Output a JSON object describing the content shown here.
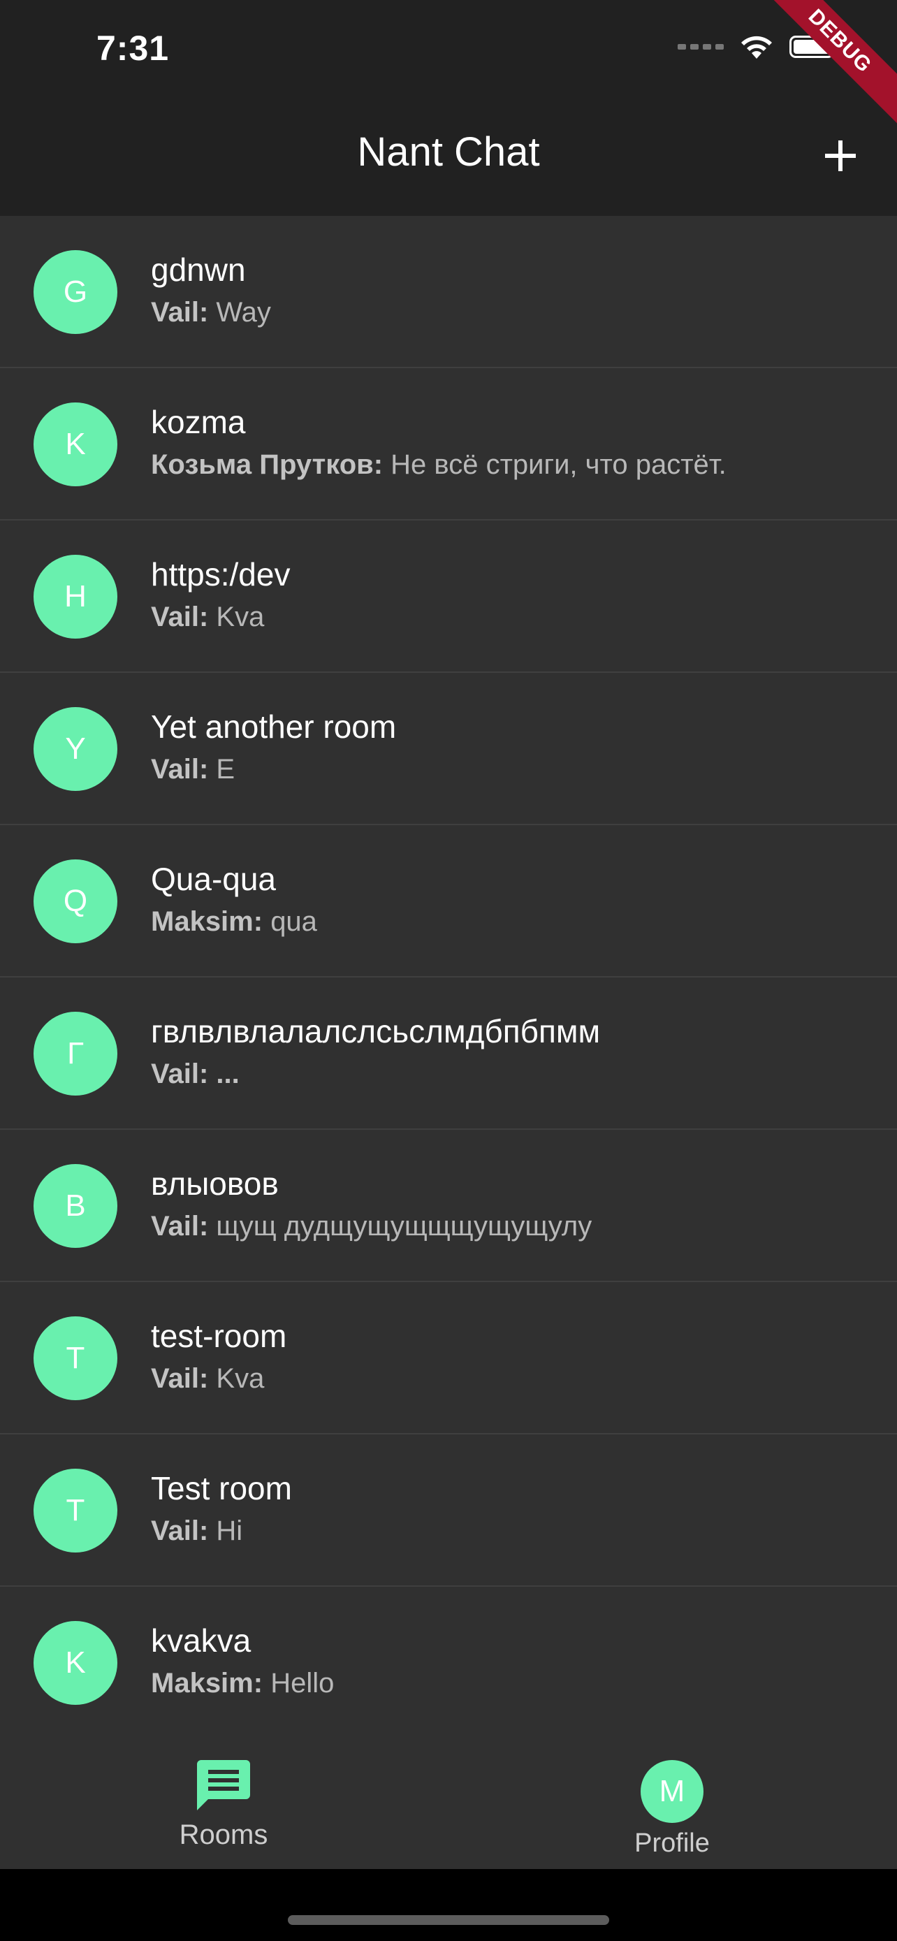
{
  "status_bar": {
    "time": "7:31",
    "icons": [
      "signal-icon",
      "wifi-icon",
      "battery-icon"
    ]
  },
  "debug_banner": "DEBUG",
  "app_bar": {
    "title": "Nant Chat",
    "add_icon": "plus-icon"
  },
  "colors": {
    "app_bar": "#212121",
    "background": "#303030",
    "accent": "#69f0ae",
    "debug": "#a3122b"
  },
  "rooms": [
    {
      "initial": "G",
      "name": "gdnwn",
      "author": "Vail:",
      "message": "Way"
    },
    {
      "initial": "K",
      "name": "kozma",
      "author": "Козьма Прутков:",
      "message": "Не всё стриги, что растёт."
    },
    {
      "initial": "H",
      "name": "https:/dev",
      "author": "Vail:",
      "message": "Kva"
    },
    {
      "initial": "Y",
      "name": "Yet another room",
      "author": "Vail:",
      "message": "E"
    },
    {
      "initial": "Q",
      "name": "Qua-qua",
      "author": "Maksim:",
      "message": "qua"
    },
    {
      "initial": "Г",
      "name": "гвлвлвлалалслсьслмдбпбпмм",
      "author": "Vail: ...",
      "message": ""
    },
    {
      "initial": "В",
      "name": "влыовов",
      "author": "Vail:",
      "message": "щущ дудщущущщщущущулу"
    },
    {
      "initial": "T",
      "name": "test-room",
      "author": "Vail:",
      "message": "Kva"
    },
    {
      "initial": "T",
      "name": "Test room",
      "author": "Vail:",
      "message": "Hi"
    },
    {
      "initial": "K",
      "name": "kvakva",
      "author": "Maksim:",
      "message": "Hello"
    }
  ],
  "bottom_nav": {
    "rooms_label": "Rooms",
    "rooms_icon": "chat-icon",
    "profile_label": "Profile",
    "profile_initial": "M"
  }
}
